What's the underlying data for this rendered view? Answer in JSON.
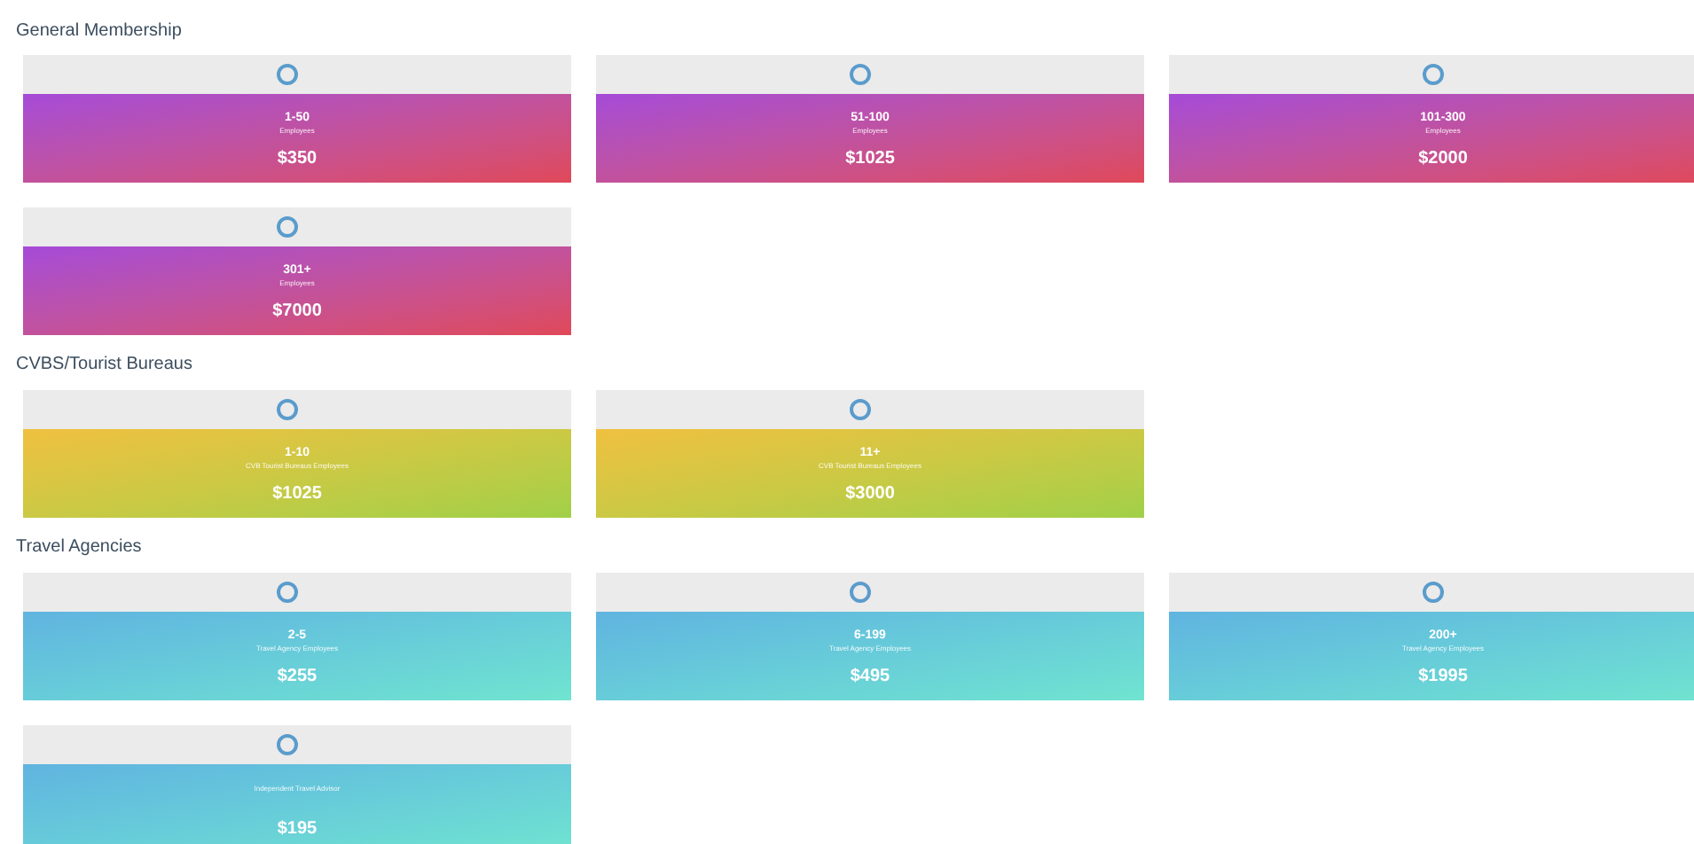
{
  "sections": [
    {
      "heading": "General Membership",
      "kind": "purple",
      "options": [
        {
          "range": "1-50",
          "label": "Employees",
          "price": "$350",
          "selected": false
        },
        {
          "range": "51-100",
          "label": "Employees",
          "price": "$1025",
          "selected": false
        },
        {
          "range": "101-300",
          "label": "Employees",
          "price": "$2000",
          "selected": false
        },
        {
          "range": "301+",
          "label": "Employees",
          "price": "$7000",
          "selected": false
        }
      ]
    },
    {
      "heading": "CVBS/Tourist Bureaus",
      "kind": "yellow",
      "options": [
        {
          "range": "1-10",
          "label": "CVB Tourist Bureaus Employees",
          "price": "$1025",
          "selected": false
        },
        {
          "range": "11+",
          "label": "CVB Tourist Bureaus Employees",
          "price": "$3000",
          "selected": false
        }
      ]
    },
    {
      "heading": "Travel Agencies",
      "kind": "teal",
      "options": [
        {
          "range": "2-5",
          "label": "Travel Agency Employees",
          "price": "$255",
          "selected": false
        },
        {
          "range": "6-199",
          "label": "Travel Agency Employees",
          "price": "$495",
          "selected": false
        },
        {
          "range": "200+",
          "label": "Travel Agency Employees",
          "price": "$1995",
          "selected": false
        },
        {
          "label": "Independent Travel Advisor",
          "price": "$195",
          "selected": false
        }
      ]
    }
  ]
}
